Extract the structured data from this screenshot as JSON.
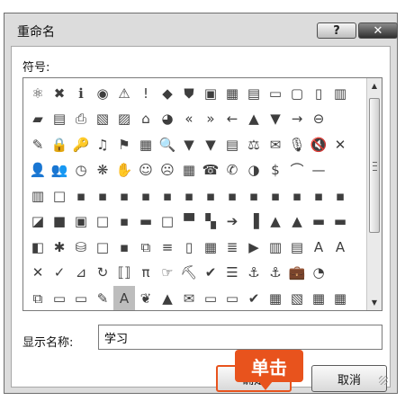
{
  "dialog": {
    "title": "重命名",
    "help_label": "?",
    "close_label": "✕"
  },
  "symbols": {
    "label": "符号:",
    "rows": [
      [
        "⚛",
        "✖",
        "ℹ",
        "◉",
        "⚠",
        "!",
        "◆",
        "⛊",
        "▣",
        "▦",
        "▤",
        "▭",
        "▢",
        "▯",
        "▥"
      ],
      [
        "▰",
        "▤",
        "⎙",
        "▧",
        "▨",
        "⌂",
        "◕",
        "«",
        "»",
        "←",
        "▲",
        "▼",
        "→",
        "⊖"
      ],
      [
        "✎",
        "🔒",
        "🔑",
        "♫",
        "⚑",
        "▦",
        "🔍",
        "▼",
        "▼",
        "▤",
        "⚖",
        "✉",
        "🎙",
        "🔇",
        "✕"
      ],
      [
        "👤",
        "👥",
        "◷",
        "❋",
        "✋",
        "☺",
        "☹",
        "▦",
        "☎",
        "✆",
        "◑",
        "$",
        "⌒",
        "—"
      ],
      [
        "▥",
        "□",
        "▪",
        "▪",
        "▪",
        "▪",
        "▪",
        "▪",
        "▪",
        "▪",
        "▪",
        "▪",
        "▪",
        "▪",
        "▪"
      ],
      [
        "◪",
        "■",
        "▣",
        "□",
        "▪",
        "▬",
        "□",
        "▀",
        "▚",
        "➔",
        "▐",
        "▲",
        "▲",
        "▬",
        "▬"
      ],
      [
        "◧",
        "✱",
        "⛁",
        "□",
        "▪",
        "⧉",
        "≡",
        "▯",
        "▦",
        "≣",
        "▶",
        "▥",
        "▤",
        "A",
        "A"
      ],
      [
        "✕",
        "✓",
        "⊿",
        "↻",
        "⟦⟧",
        "π",
        "☞",
        "⛏",
        "✔",
        "☰",
        "⚓",
        "⚓",
        "💼",
        "◔"
      ],
      [
        "⧉",
        "▭",
        "▭",
        "✎",
        "A",
        "❦",
        "▲",
        "✉",
        "▭",
        "▭",
        "✔",
        "▦",
        "▧",
        "▦",
        "▦"
      ],
      [
        "◍",
        "⌂",
        "⚲",
        "—",
        "▭",
        "▭",
        "▭",
        "▭",
        "◆",
        "▭",
        "▦",
        "▦",
        "▭",
        "▭",
        "▯"
      ]
    ]
  },
  "display_name": {
    "label": "显示名称:",
    "value": "学习"
  },
  "buttons": {
    "ok": "确定",
    "cancel": "取消"
  },
  "callout": {
    "text": "单击"
  }
}
